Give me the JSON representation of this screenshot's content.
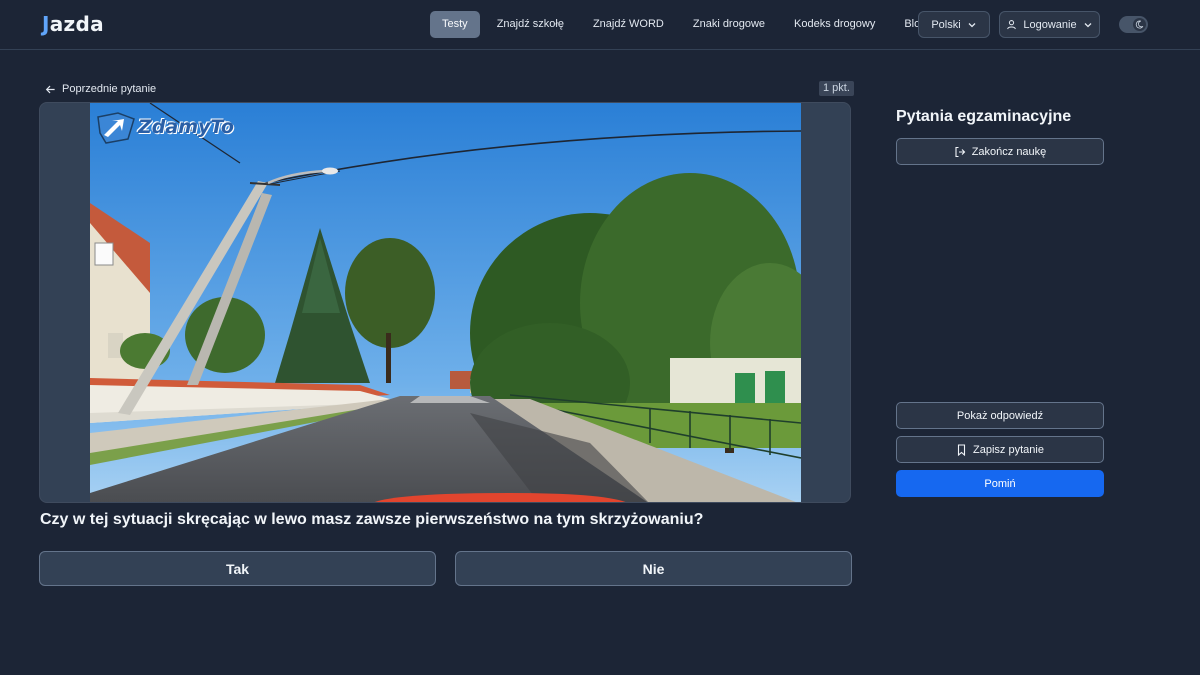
{
  "logo": {
    "text": "azda"
  },
  "nav": {
    "items": [
      "Testy",
      "Znajdź szkołę",
      "Znajdź WORD",
      "Znaki drogowe",
      "Kodeks drogowy",
      "Blog"
    ],
    "language": "Polski",
    "login": "Logowanie"
  },
  "question": {
    "back_label": "Poprzednie pytanie",
    "points": "1 pkt.",
    "media_watermark": "ZdamyTo",
    "text": "Czy w tej sytuacji skręcając w lewo masz zawsze pierwszeństwo na tym skrzyżowaniu?",
    "answers": [
      "Tak",
      "Nie"
    ]
  },
  "side": {
    "title": "Pytania egzaminacyjne",
    "finish_label": "Zakończ naukę",
    "show_answer_label": "Pokaż odpowiedź",
    "save_label": "Zapisz pytanie",
    "skip_label": "Pomiń"
  },
  "colors": {
    "background": "#1c2536",
    "primary": "#1668f0",
    "active_nav": "#64748b"
  }
}
